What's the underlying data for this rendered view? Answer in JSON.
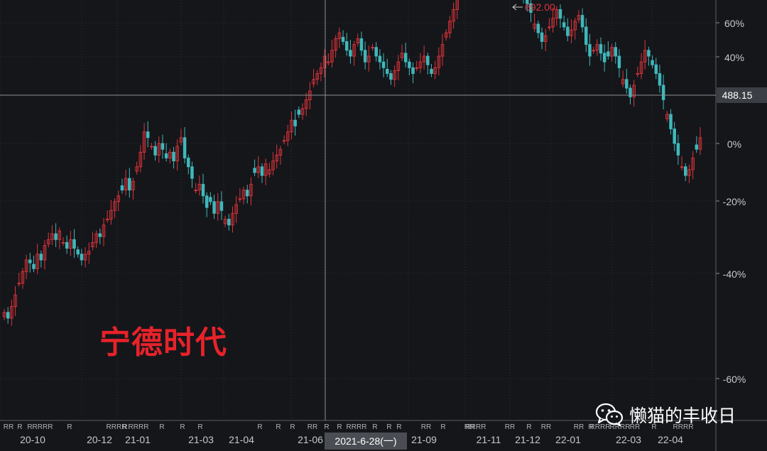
{
  "stock_name": "宁德时代",
  "watermark": {
    "text": "懒猫的丰收日",
    "icon": "wechat-icon"
  },
  "crosshair": {
    "price_label": "488.15",
    "date_label": "2021-6-28(一)"
  },
  "colors": {
    "up": "#e0343a",
    "down": "#3fb8bb",
    "grid": "#2f3238",
    "axis_text": "#c8c8c8",
    "background": "#14161a"
  },
  "chart_data": {
    "type": "candlestick",
    "title": "宁德时代",
    "y_axis": {
      "ticks": [
        "60%",
        "40%",
        "0%",
        "-20%",
        "-40%",
        "-60%"
      ],
      "side": "right",
      "grid": true
    },
    "x_axis": {
      "ticks": [
        "20-10",
        "20-12",
        "21-01",
        "21-03",
        "21-04",
        "21-06",
        "21-09",
        "21-11",
        "21-12",
        "22-01",
        "22-03",
        "22-04"
      ]
    },
    "annotation": {
      "label": "692.00",
      "type": "max-price"
    },
    "markers": [
      "RR",
      "R",
      "R",
      "RRRR",
      "R",
      "RRRR",
      "R",
      "RRRR",
      "R",
      "R",
      "R",
      "R",
      "R",
      "R",
      "RR",
      "R",
      "R",
      "RRRR",
      "R",
      "R",
      "R",
      "RR",
      "R",
      "RR",
      "RRRR",
      "RR",
      "R",
      "RR",
      "RR",
      "R",
      "RRRR",
      "RRRR",
      "RR",
      "R",
      "RRRR"
    ],
    "closes": [
      -58,
      -60,
      -56,
      -52,
      -48,
      -44,
      -40,
      -41,
      -43,
      -38,
      -40,
      -35,
      -33,
      -31,
      -33,
      -30,
      -34,
      -36,
      -33,
      -36,
      -38,
      -40,
      -38,
      -37,
      -34,
      -31,
      -32,
      -28,
      -26,
      -23,
      -20,
      -18,
      -16,
      -12,
      -16,
      -13,
      -8,
      -3,
      4,
      2,
      -1,
      -4,
      0,
      -2,
      -5,
      -3,
      -6,
      -1,
      2,
      -5,
      -8,
      -12,
      -16,
      -14,
      -18,
      -22,
      -20,
      -24,
      -20,
      -23,
      -26,
      -28,
      -24,
      -21,
      -19,
      -16,
      -18,
      -14,
      -10,
      -8,
      -11,
      -7,
      -9,
      -6,
      -4,
      -2,
      1,
      4,
      8,
      6,
      10,
      12,
      15,
      18,
      22,
      24,
      26,
      30,
      28,
      32,
      36,
      38,
      35,
      32,
      30,
      34,
      36,
      32,
      28,
      30,
      33,
      30,
      28,
      26,
      24,
      22,
      25,
      28,
      31,
      28,
      26,
      24,
      26,
      28,
      30,
      27,
      24,
      26,
      30,
      34,
      38,
      42,
      46,
      50,
      53,
      55,
      58,
      60,
      62,
      59,
      61,
      63,
      61,
      58,
      60,
      62,
      64,
      62,
      60,
      57,
      53,
      50,
      48,
      45,
      41,
      38,
      35,
      37,
      40,
      43,
      46,
      43,
      40,
      37,
      39,
      42,
      44,
      40,
      34,
      30,
      32,
      34,
      31,
      28,
      30,
      33,
      30,
      26,
      22,
      19,
      16,
      20,
      24,
      28,
      32,
      30,
      27,
      24,
      20,
      15,
      10,
      5,
      0,
      -4,
      -8,
      -11,
      -9,
      -5,
      -2,
      2
    ]
  }
}
